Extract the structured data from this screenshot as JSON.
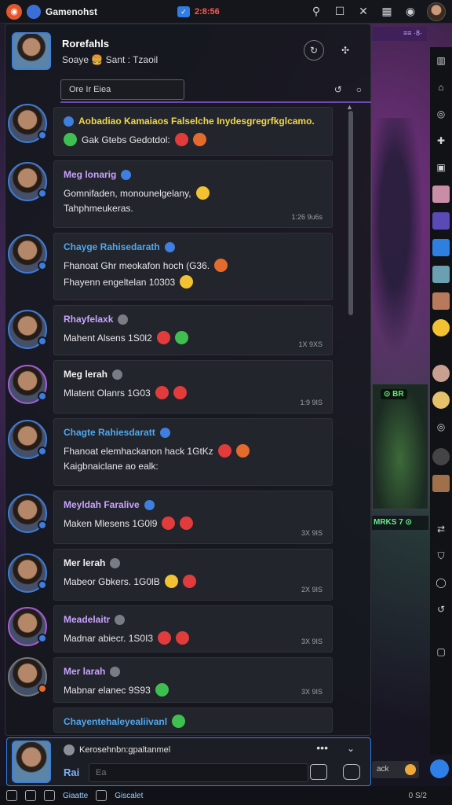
{
  "window": {
    "app_name": "Gamenohst",
    "record_label": "2:8:56"
  },
  "header": {
    "title": "Rorefahls",
    "subtitle": "Soaye 🍔 Sant : Tzaoil"
  },
  "filter": {
    "value": "Ore Ir Eiea"
  },
  "messages": [
    {
      "name": "Aobadiao Kamaiaos Falselche Inydesgregrfkglcamo.",
      "lines": [
        "Gak Gtebs Gedotdol:"
      ],
      "time": "",
      "color": "#f2d74a"
    },
    {
      "name": "Meg lonarig",
      "lines": [
        "Gomnifaden, monounelgelany,",
        "Tahphmeukeras."
      ],
      "time": "1:26 9u6s",
      "color": "#c9a3ff"
    },
    {
      "name": "Chayge Rahisedarath",
      "lines": [
        "Fhanoat Ghr meokafon hoch (G36.",
        "Fhayenn engeltelan 10303"
      ],
      "time": "",
      "color": "#4fa8f0"
    },
    {
      "name": "Rhayfelaxk",
      "lines": [
        "Mahent Alsens 1S0l2"
      ],
      "time": "1X 9XS",
      "color": "#c9a3ff"
    },
    {
      "name": "Meg lerah",
      "lines": [
        "Mlatent Olanrs 1G03"
      ],
      "time": "1:9 9IS",
      "color": "#f2f2f2"
    },
    {
      "name": "Chagte Rahiesdaratt",
      "lines": [
        "Fhanoat elemhackanon hack 1GtKz",
        "Kaigbnaiclane ao ealk:"
      ],
      "time": "",
      "color": "#4fa8f0"
    },
    {
      "name": "Meyldah Faralive",
      "lines": [
        "Maken Mlesens 1G0l9"
      ],
      "time": "3X 9IS",
      "color": "#c9a3ff"
    },
    {
      "name": "Mer lerah",
      "lines": [
        "Mabeor Gbkers. 1G0lB"
      ],
      "time": "2X 9IS",
      "color": "#f2f2f2"
    },
    {
      "name": "Meadelaitr",
      "lines": [
        "Madnar abiecr. 1S0I3"
      ],
      "time": "3X 9IS",
      "color": "#c9a3ff"
    },
    {
      "name": "Mer larah",
      "lines": [
        "Mabnar elanec 9S93"
      ],
      "time": "3X 9IS",
      "color": "#c9a3ff"
    },
    {
      "name": "Chayentehaleyealiivanl",
      "lines": [],
      "time": "",
      "color": "#4fa8f0"
    }
  ],
  "composer": {
    "title": "Kerosehnbn:gpaltanmel",
    "prefix": "Rai",
    "placeholder": "Ea"
  },
  "statusbar": {
    "label1": "Giaatte",
    "label2": "Giscalet",
    "right": "0 S/2"
  },
  "game": {
    "top_label": "≡≡ ·8·",
    "thumb_badge": "⊙ BR",
    "label2": "MRKS 7 ⊙",
    "bottom_label": "ack"
  },
  "colors": {
    "accent": "#3e7fdc",
    "panel": "#23252c",
    "highlight": "#6e4bb0"
  }
}
